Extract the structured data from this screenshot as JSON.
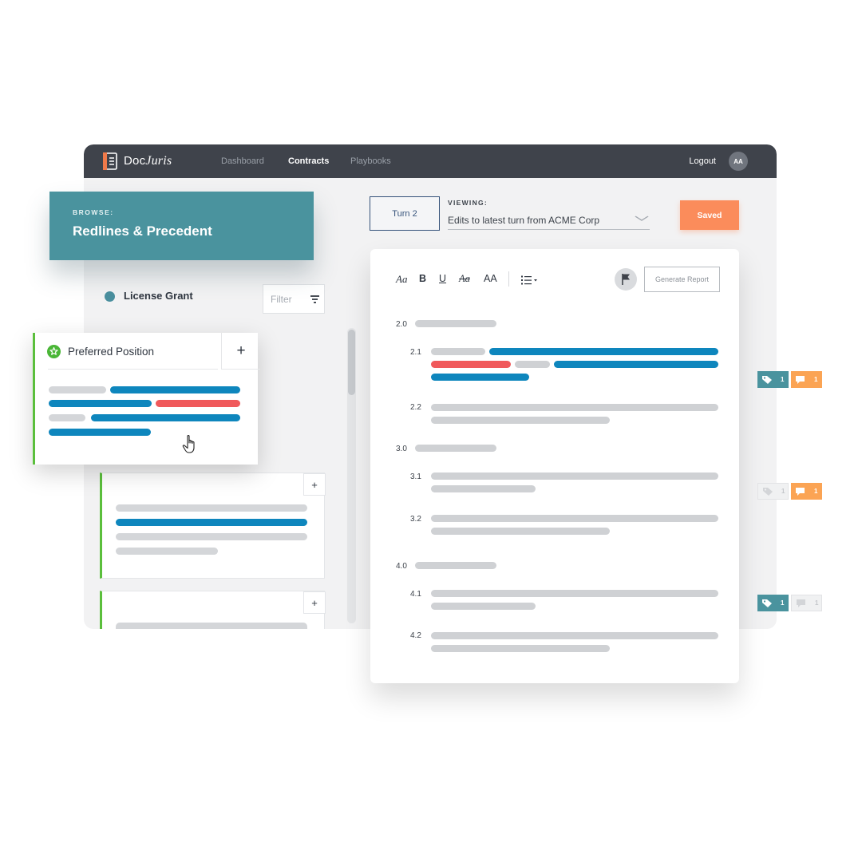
{
  "nav": {
    "logo_doc": "Doc",
    "logo_juris": "Juris",
    "links": [
      "Dashboard",
      "Contracts",
      "Playbooks"
    ],
    "active": "Contracts",
    "logout": "Logout",
    "avatar_initials": "AA"
  },
  "browse": {
    "label": "BROWSE:",
    "title": "Redlines & Precedent"
  },
  "clause": {
    "name": "License Grant",
    "filter_placeholder": "Filter"
  },
  "preferred": {
    "title": "Preferred Position",
    "add": "+",
    "icon": "star-icon"
  },
  "cards": {
    "add": "+"
  },
  "turn": {
    "label": "Turn 2"
  },
  "viewing": {
    "label": "VIEWING:",
    "value": "Edits to latest turn from ACME Corp"
  },
  "saved": "Saved",
  "toolbar": {
    "font": "Aa",
    "bold": "B",
    "underline": "U",
    "strike": "Aa",
    "case": "AA",
    "report": "Generate Report"
  },
  "sections": {
    "s20": "2.0",
    "s21": "2.1",
    "s22": "2.2",
    "s30": "3.0",
    "s31": "3.1",
    "s32": "3.2",
    "s40": "4.0",
    "s41": "4.1",
    "s42": "4.2"
  },
  "tags": [
    {
      "tag_count": "1",
      "comment_count": "1",
      "tag_active": true,
      "comment_active": true
    },
    {
      "tag_count": "1",
      "comment_count": "1",
      "tag_active": false,
      "comment_active": true
    },
    {
      "tag_count": "1",
      "comment_count": "1",
      "tag_active": true,
      "comment_active": false
    }
  ],
  "colors": {
    "teal": "#4a939e",
    "orange": "#fb8c5b",
    "blue": "#0e86bd",
    "red": "#f0595b",
    "green": "#5bbf3c",
    "nav": "#3f434b"
  }
}
